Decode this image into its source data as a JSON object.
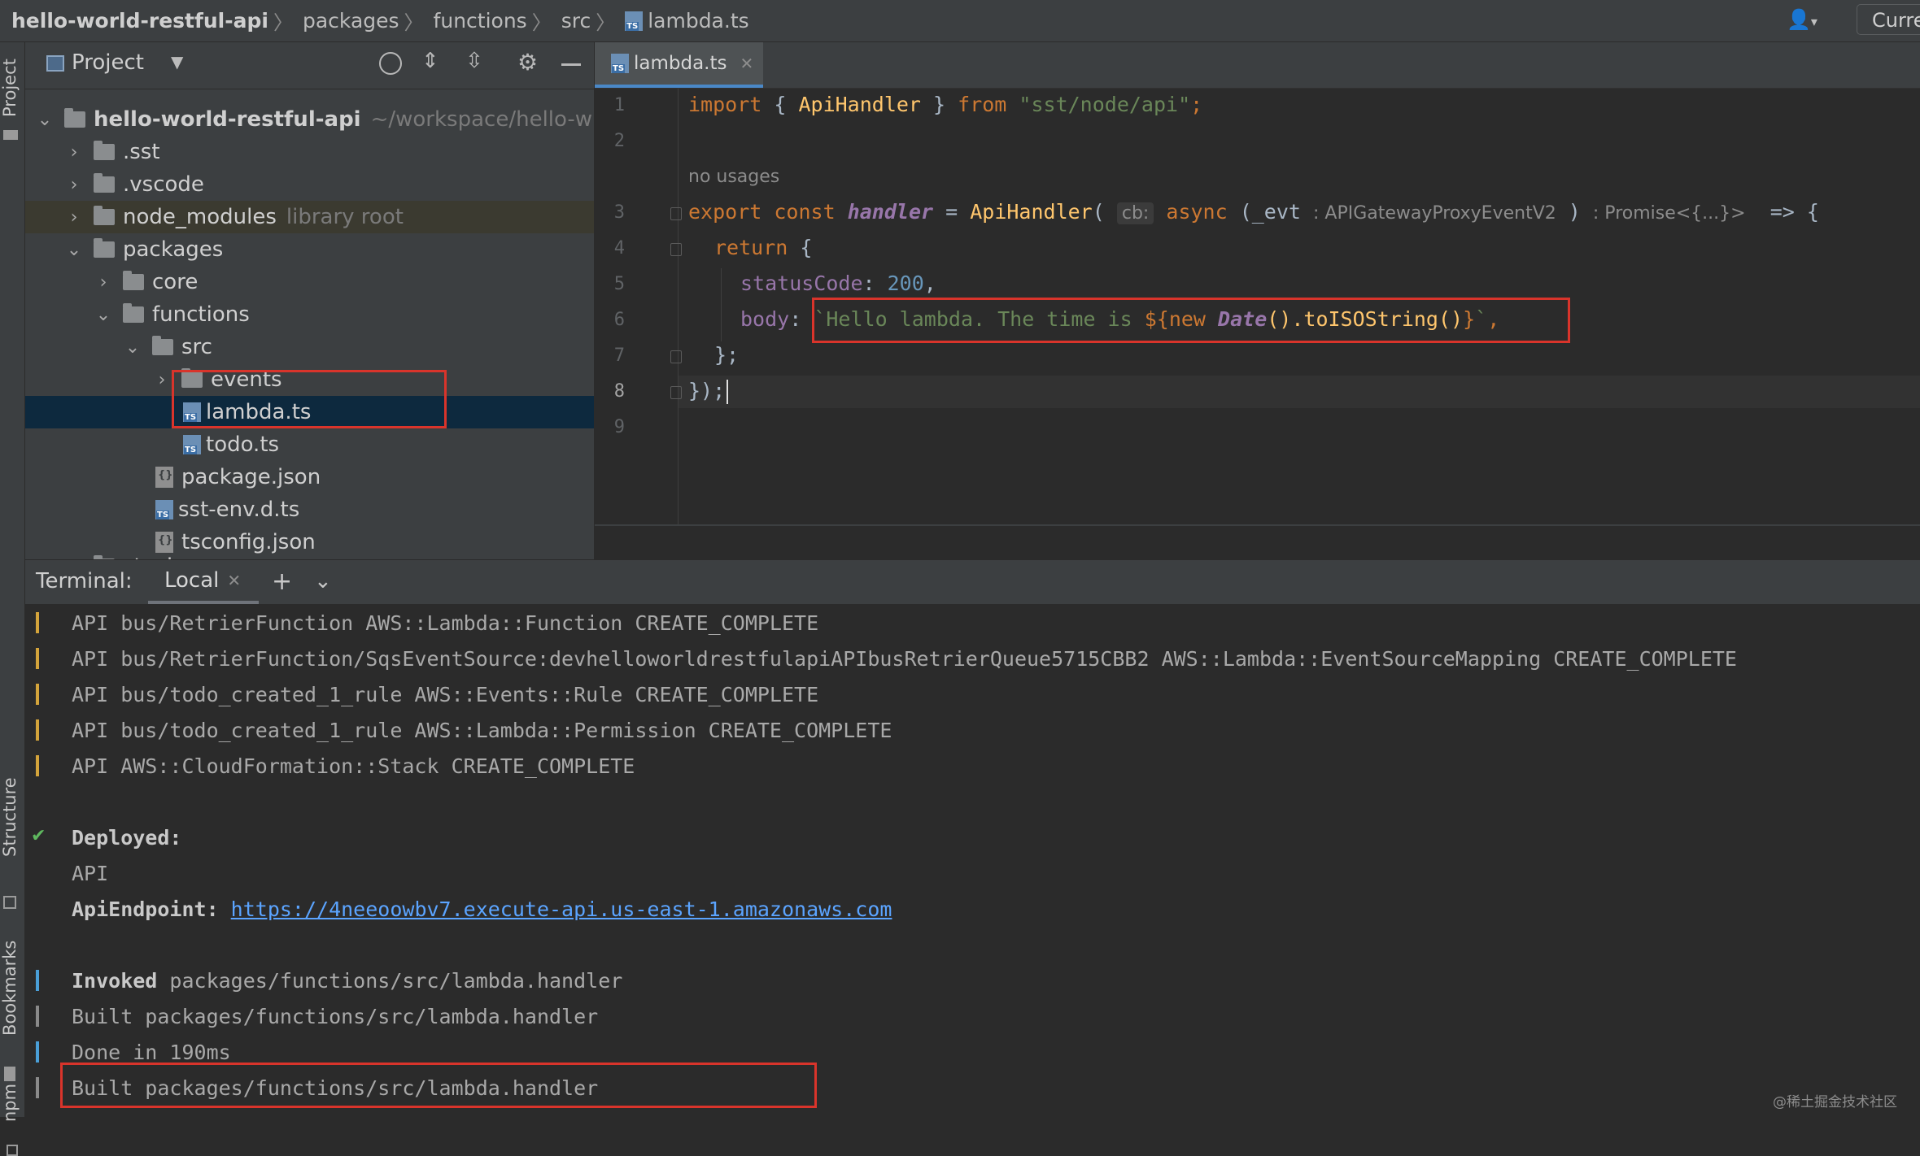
{
  "breadcrumb": [
    {
      "label": "hello-world-restful-api"
    },
    {
      "label": "packages"
    },
    {
      "label": "functions"
    },
    {
      "label": "src"
    },
    {
      "label": "lambda.ts"
    }
  ],
  "toolbar": {
    "current_label": "Curre"
  },
  "side_tools": {
    "project": "Project",
    "structure": "Structure",
    "bookmarks": "Bookmarks",
    "npm": "npm"
  },
  "project_panel": {
    "title": "Project",
    "tree": {
      "root": {
        "name": "hello-world-restful-api",
        "path": "~/workspace/hello-w"
      },
      "sst": ".sst",
      "vscode": ".vscode",
      "node_modules": {
        "name": "node_modules",
        "hint": "library root"
      },
      "packages": "packages",
      "core": "core",
      "functions": "functions",
      "src": "src",
      "events": "events",
      "lambda": "lambda.ts",
      "todo": "todo.ts",
      "package_json": "package.json",
      "sst_env": "sst-env.d.ts",
      "tsconfig": "tsconfig.json",
      "stacks": "stacks"
    }
  },
  "editor": {
    "tab": "lambda.ts",
    "line_numbers": [
      "1",
      "2",
      "3",
      "4",
      "5",
      "6",
      "7",
      "8",
      "9"
    ],
    "no_usages": "no usages",
    "l1": {
      "import": "import",
      "b1": " { ",
      "name": "ApiHandler",
      "b2": " } ",
      "from": "from",
      "sp": " ",
      "module": "\"sst/node/api\"",
      "semi": ";"
    },
    "l3": {
      "export": "export",
      "sp1": " ",
      "const": "const",
      "sp2": " ",
      "handler": "handler",
      "eq": " = ",
      "fn": "ApiHandler",
      "paren": "(",
      "cb_hint": "cb:",
      "async": " async",
      "arg": " (_evt ",
      "type_hint": ": APIGatewayProxyEventV2",
      "close": " ) ",
      "ret_hint": ": Promise<{...}>",
      "arrow": "  => {"
    },
    "l4": {
      "ret": "return",
      "brace": " {"
    },
    "l5": {
      "key": "statusCode",
      "colon": ": ",
      "val": "200",
      "comma": ","
    },
    "l6": {
      "key": "body",
      "colon": ": ",
      "str1": "`Hello lambda. The time is ",
      "interp": "${",
      "new": "new",
      "date": " Date",
      "call": "().toISOString()",
      "close": "}",
      "str2": "`",
      "comma": ","
    },
    "l7": "};",
    "l8": "});"
  },
  "terminal": {
    "title": "Terminal:",
    "tab": "Local",
    "lines": [
      "API bus/RetrierFunction AWS::Lambda::Function CREATE_COMPLETE",
      "API bus/RetrierFunction/SqsEventSource:devhelloworldrestfulapiAPIbusRetrierQueue5715CBB2 AWS::Lambda::EventSourceMapping CREATE_COMPLETE",
      "API bus/todo_created_1_rule AWS::Events::Rule CREATE_COMPLETE",
      "API bus/todo_created_1_rule AWS::Lambda::Permission CREATE_COMPLETE",
      "API AWS::CloudFormation::Stack CREATE_COMPLETE"
    ],
    "check": "✔",
    "deployed": "Deployed:",
    "api": "API",
    "endpoint_label": "ApiEndpoint: ",
    "endpoint_url": "https://4neeoowbv7.execute-api.us-east-1.amazonaws.com",
    "invoked_word": "Invoked",
    "invoked_path": " packages/functions/src/lambda.handler",
    "built1": "Built packages/functions/src/lambda.handler",
    "done": "Done in 190ms",
    "built2": "Built packages/functions/src/lambda.handler"
  },
  "watermark": "@稀土掘金技术社区",
  "colors": {
    "accent_tab": "#4a88c7",
    "annotation_red": "#d9342b",
    "link": "#5ba4ff",
    "terminal_bar": "#d4a43b",
    "terminal_bar_blue": "#4a9fd8"
  }
}
